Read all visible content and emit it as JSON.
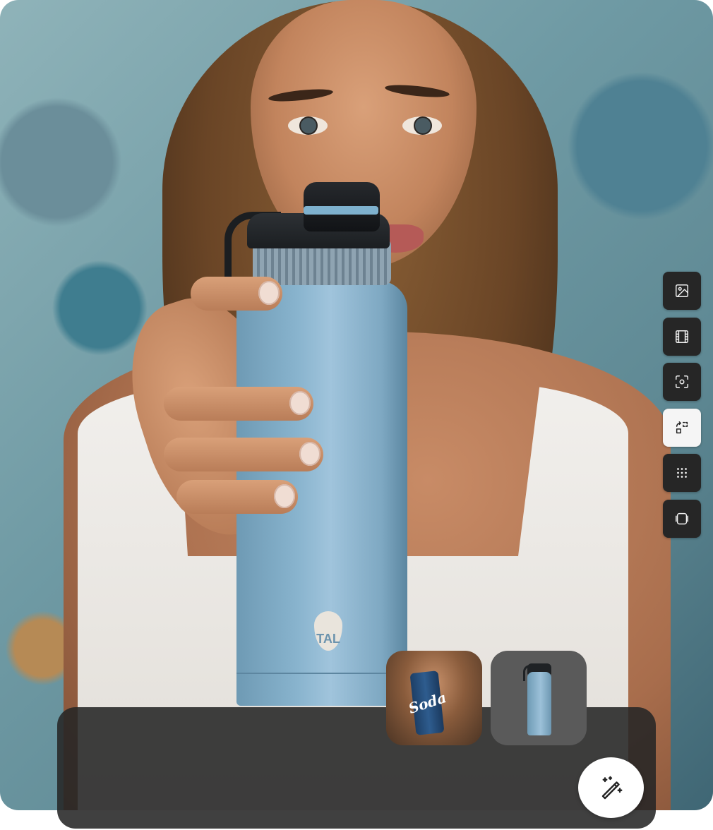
{
  "canvas": {
    "bottle_logo": "TAL",
    "scene": "woman-holding-water-bottle"
  },
  "tool_rail": {
    "items": [
      {
        "icon": "image-icon",
        "active": false
      },
      {
        "icon": "film-icon",
        "active": false
      },
      {
        "icon": "focus-icon",
        "active": false
      },
      {
        "icon": "replace-icon",
        "active": true
      },
      {
        "icon": "grid-dots-icon",
        "active": false
      },
      {
        "icon": "layers-icon",
        "active": false
      }
    ]
  },
  "thumbnails": [
    {
      "label": "Soda"
    },
    {
      "label": ""
    }
  ],
  "colors": {
    "panel_bg": "#262626",
    "tool_bg": "#262626",
    "tool_active_bg": "#f5f5f5",
    "bottle_blue": "#88b3cd"
  },
  "actions": {
    "generate_icon": "magic-wand-icon"
  }
}
